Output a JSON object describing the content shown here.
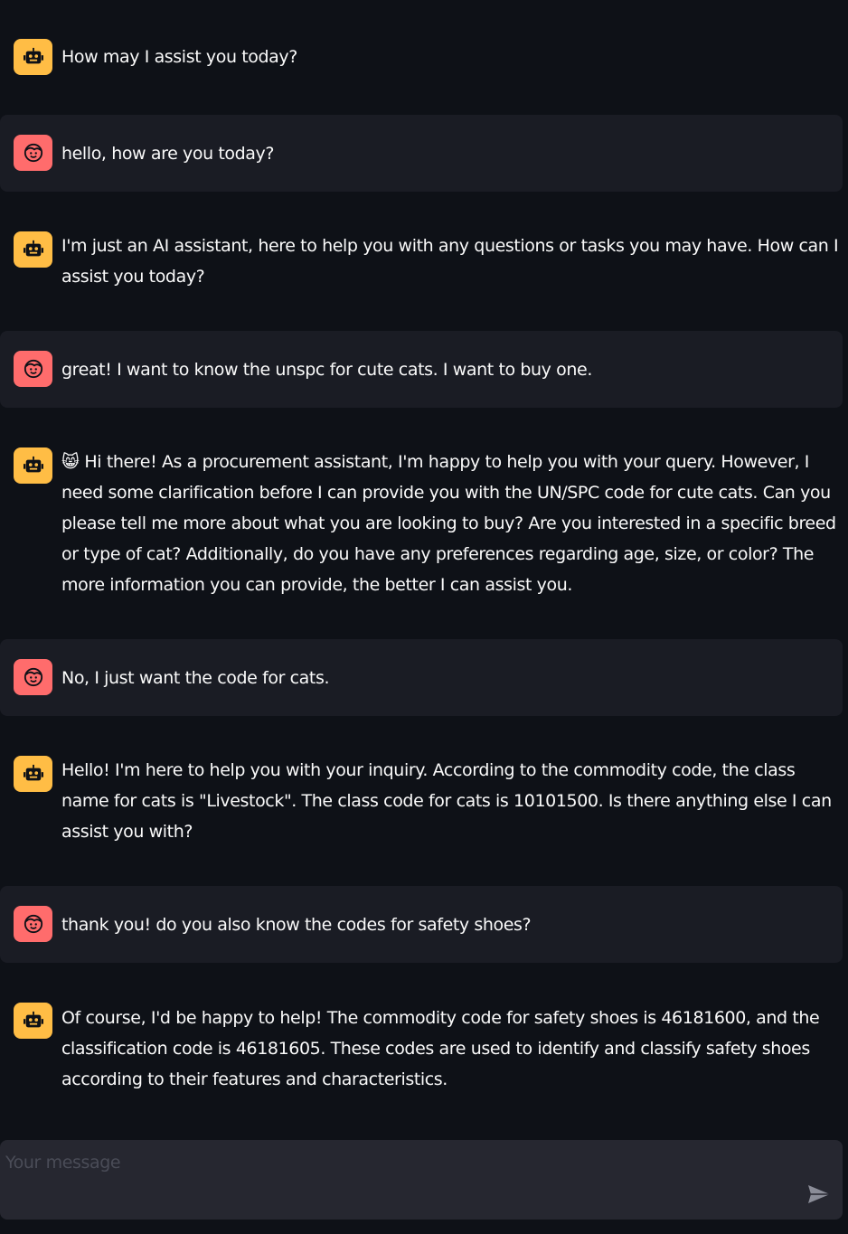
{
  "messages": [
    {
      "role": "assistant",
      "text": "How may I assist you today?"
    },
    {
      "role": "user",
      "text": "hello, how are you today?"
    },
    {
      "role": "assistant",
      "text": "I'm just an AI assistant, here to help you with any questions or tasks you may have. How can I assist you today?"
    },
    {
      "role": "user",
      "text": "great! I want to know the unspc for cute cats. I want to buy one."
    },
    {
      "role": "assistant",
      "emoji": "😸",
      "text": "Hi there! As a procurement assistant, I'm happy to help you with your query. However, I need some clarification before I can provide you with the UN/SPC code for cute cats. Can you please tell me more about what you are looking to buy? Are you interested in a specific breed or type of cat? Additionally, do you have any preferences regarding age, size, or color? The more information you can provide, the better I can assist you."
    },
    {
      "role": "user",
      "text": "No, I just want the code for cats."
    },
    {
      "role": "assistant",
      "text": "Hello! I'm here to help you with your inquiry. According to the commodity code, the class name for cats is \"Livestock\". The class code for cats is 10101500. Is there anything else I can assist you with?"
    },
    {
      "role": "user",
      "text": "thank you! do you also know the codes for safety shoes?"
    },
    {
      "role": "assistant",
      "text": "Of course, I'd be happy to help! The commodity code for safety shoes is 46181600, and the classification code is 46181605. These codes are used to identify and classify safety shoes according to their features and characteristics."
    }
  ],
  "input": {
    "placeholder": "Your message",
    "value": ""
  },
  "icons": {
    "assistant_avatar": "robot-face-icon",
    "user_avatar": "smiley-face-icon",
    "send": "send-arrow-icon"
  },
  "colors": {
    "background": "#0e1117",
    "user_row": "#1a1c24",
    "assistant_avatar": "#ffbd45",
    "user_avatar": "#ff6c6c",
    "input_bg": "#262730"
  }
}
